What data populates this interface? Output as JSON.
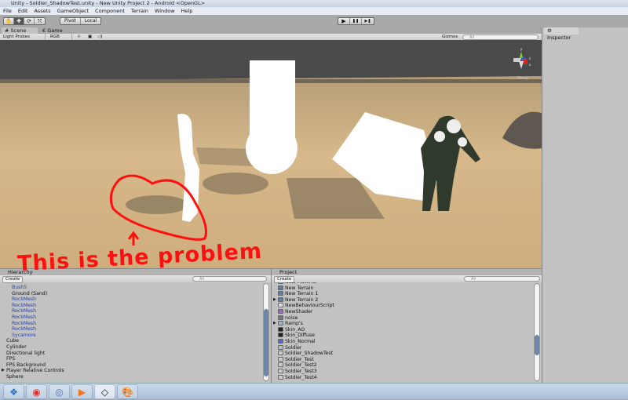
{
  "window": {
    "title": "Unity - Soldier_ShadowTest.unity - New Unity Project 2 - Android <OpenGL>"
  },
  "menu": [
    "File",
    "Edit",
    "Assets",
    "GameObject",
    "Component",
    "Terrain",
    "Window",
    "Help"
  ],
  "toolbar": {
    "pivot": "Pivot",
    "local": "Local",
    "play": "▶",
    "pause": "❚❚",
    "step": "▶❚"
  },
  "tabs": {
    "scene": "Scene",
    "game": "Game",
    "inspector": "Inspector"
  },
  "scenebar": {
    "render_mode": "Light Probes",
    "color_mode": "RGB",
    "gizmos": "Gizmos",
    "search_placeholder": "All"
  },
  "gizmo": {
    "y": "y",
    "z": "z",
    "x": "x",
    "projection": "Persp"
  },
  "annotation": "This is the problem",
  "hierarchy": {
    "title": "Hierarchy",
    "create": "Create",
    "search_placeholder": "All",
    "items": [
      {
        "label": "Bush5",
        "indent": 1,
        "prefab": true
      },
      {
        "label": "Ground (Sand)",
        "indent": 1,
        "prefab": false
      },
      {
        "label": "RockMesh",
        "indent": 1,
        "prefab": true
      },
      {
        "label": "RockMesh",
        "indent": 1,
        "prefab": true
      },
      {
        "label": "RockMesh",
        "indent": 1,
        "prefab": true
      },
      {
        "label": "RockMesh",
        "indent": 1,
        "prefab": true
      },
      {
        "label": "RockMesh",
        "indent": 1,
        "prefab": true
      },
      {
        "label": "RockMesh",
        "indent": 1,
        "prefab": true
      },
      {
        "label": "Sycamore",
        "indent": 1,
        "prefab": true
      },
      {
        "label": "Cube",
        "indent": 0,
        "prefab": false
      },
      {
        "label": "Cylinder",
        "indent": 0,
        "prefab": false
      },
      {
        "label": "Directional light",
        "indent": 0,
        "prefab": false
      },
      {
        "label": "FPS",
        "indent": 0,
        "prefab": false
      },
      {
        "label": "FPS Background",
        "indent": 0,
        "prefab": false
      },
      {
        "label": "Player Relative Controls",
        "indent": 0,
        "prefab": false,
        "expandable": true
      },
      {
        "label": "Sphere",
        "indent": 0,
        "prefab": false
      }
    ]
  },
  "project": {
    "title": "Project",
    "create": "Create",
    "search_placeholder": "All",
    "items": [
      {
        "label": "New Material",
        "icon": "material"
      },
      {
        "label": "New Terrain",
        "icon": "terrain"
      },
      {
        "label": "New Terrain 1",
        "icon": "terrain"
      },
      {
        "label": "New Terrain 2",
        "icon": "terrain",
        "expandable": true
      },
      {
        "label": "NewBehaviourScript",
        "icon": "script"
      },
      {
        "label": "NewShader",
        "icon": "shader"
      },
      {
        "label": "noise",
        "icon": "texture"
      },
      {
        "label": "Ramp's",
        "icon": "folder",
        "expandable": true
      },
      {
        "label": "Skin_AO",
        "icon": "texture-bw"
      },
      {
        "label": "Skin_Diffuse",
        "icon": "texture-bw"
      },
      {
        "label": "Skin_Normal",
        "icon": "normal-map"
      },
      {
        "label": "Soldier",
        "icon": "prefab"
      },
      {
        "label": "Soldier_ShadowTest",
        "icon": "scene"
      },
      {
        "label": "Soldier_Test",
        "icon": "scene"
      },
      {
        "label": "Soldier_Test2",
        "icon": "scene"
      },
      {
        "label": "Soldier_Test3",
        "icon": "scene"
      },
      {
        "label": "Soldier_Test4",
        "icon": "scene"
      }
    ]
  },
  "taskbar": [
    "start",
    "chrome",
    "app",
    "media-player",
    "unity",
    "paint"
  ]
}
